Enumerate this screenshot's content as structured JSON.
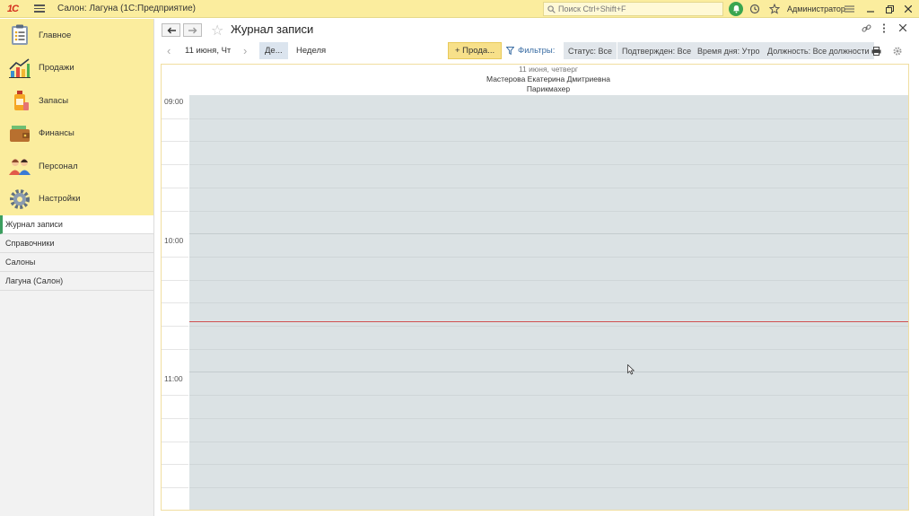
{
  "titlebar": {
    "logo": "1С",
    "app_title": "Салон: Лагуна  (1С:Предприятие)",
    "search_placeholder": "Поиск Ctrl+Shift+F",
    "user": "Администратор",
    "accent": "#fbed9e"
  },
  "sidebar": {
    "sections": [
      {
        "label": "Главное",
        "icon": "home-list-icon"
      },
      {
        "label": "Продажи",
        "icon": "sales-chart-icon"
      },
      {
        "label": "Запасы",
        "icon": "stock-bottle-icon"
      },
      {
        "label": "Финансы",
        "icon": "wallet-icon"
      },
      {
        "label": "Персонал",
        "icon": "staff-people-icon"
      },
      {
        "label": "Настройки",
        "icon": "gear-icon"
      }
    ],
    "nav_items": [
      {
        "label": "Журнал записи",
        "active": true
      },
      {
        "label": "Справочники",
        "active": false
      },
      {
        "label": "Салоны",
        "active": false
      },
      {
        "label": "Лагуна (Салон)",
        "active": false
      }
    ]
  },
  "form": {
    "title": "Журнал записи",
    "toolbar": {
      "date_label": "11 июня, Чт",
      "day_button": "Де...",
      "week_button": "Неделя",
      "sale_button": "+ Прода...",
      "filters_label": "Фильтры:",
      "chips": [
        "Статус: Все",
        "Подтвержден: Все",
        "Время дня: Утро",
        "Должность: Все должности"
      ]
    },
    "calendar": {
      "date": "11 июня, четверг",
      "employee": "Мастерова Екатерина Дмитриевна",
      "position": "Парикмахер",
      "hours": [
        "09:00",
        "10:00",
        "11:00"
      ]
    }
  },
  "colors": {
    "grid_bg": "#dbe2e4",
    "now_line": "#d05050",
    "active_marker": "#3c9e5f"
  }
}
